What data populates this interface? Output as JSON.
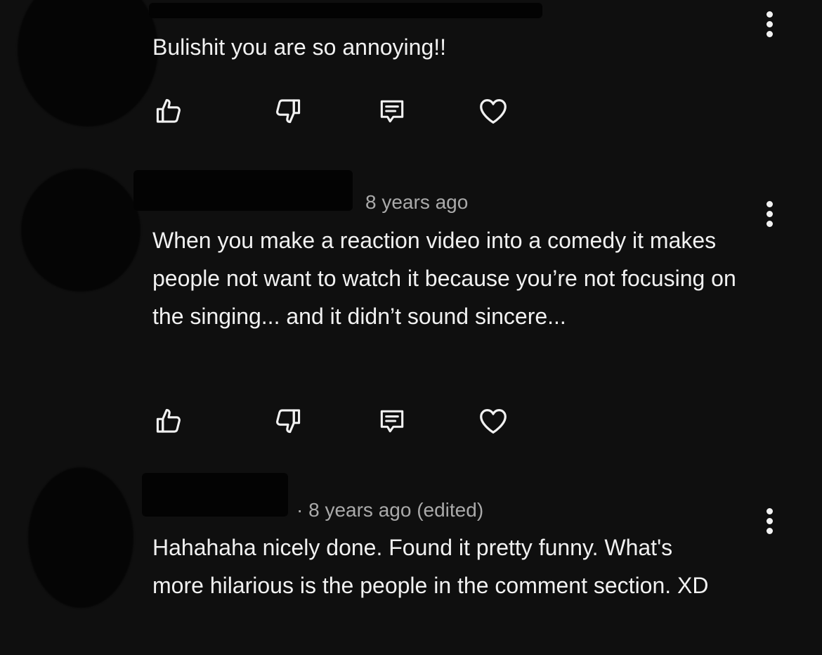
{
  "comments": [
    {
      "timestamp": "",
      "text": "Bulishit you are so annoying!!",
      "menu_icon": "more-vert-icon"
    },
    {
      "timestamp": "8 years ago",
      "text": "When you make a reaction video into a comedy it makes people not want to watch it because you’re not focusing on the singing... and it didn’t sound sincere...",
      "menu_icon": "more-vert-icon"
    },
    {
      "timestamp": "· 8 years ago (edited)",
      "text": "Hahahaha nicely done. Found it pretty funny. What's more hilarious is the people in the comment section. XD",
      "menu_icon": "more-vert-icon"
    }
  ],
  "action_icons": [
    "thumbs-up-icon",
    "thumbs-down-icon",
    "reply-icon",
    "heart-icon"
  ],
  "colors": {
    "background": "#0f0f0f",
    "text": "#f1f1f1",
    "meta": "#aaaaaa"
  }
}
